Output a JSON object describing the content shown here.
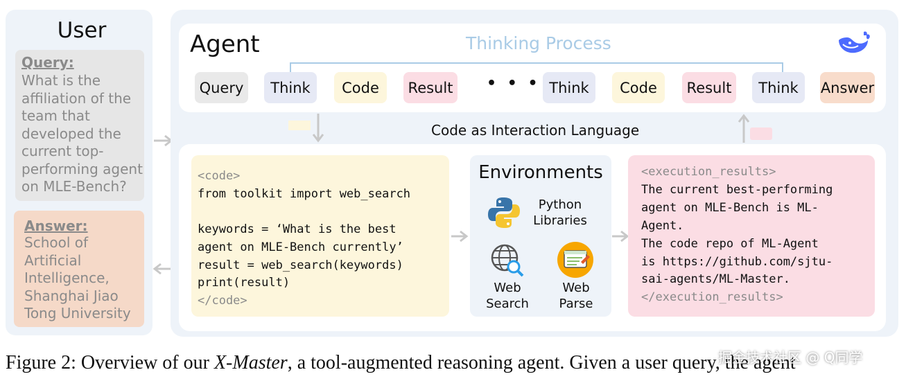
{
  "user": {
    "title": "User",
    "query_label": "Query:",
    "query_text": "What is the affiliation of the team that developed the current top-performing agent on MLE-Bench?",
    "answer_label": "Answer:",
    "answer_text": "School of Artificial Intelligence, Shanghai Jiao Tong University"
  },
  "agent": {
    "title": "Agent",
    "thinking_label": "Thinking Process",
    "logo_icon": "whale-icon",
    "flow": [
      {
        "label": "Query",
        "color": "#e9e9e9"
      },
      {
        "label": "Think",
        "color": "#e6e9f5"
      },
      {
        "label": "Code",
        "color": "#fdf6dc"
      },
      {
        "label": "Result",
        "color": "#fbdde4"
      },
      {
        "label": "Think",
        "color": "#e6e9f5"
      },
      {
        "label": "Code",
        "color": "#fdf6dc"
      },
      {
        "label": "Result",
        "color": "#fbdde4"
      },
      {
        "label": "Think",
        "color": "#e6e9f5"
      },
      {
        "label": "Answer",
        "color": "#f8dccb"
      }
    ],
    "ellipsis": "• • •",
    "interaction_label": "Code as Interaction Language"
  },
  "code": {
    "open_tag": "<code>",
    "lines": [
      "from toolkit import web_search",
      "",
      "keywords = ‘What is the best",
      "agent on MLE-Bench currently’",
      "result = web_search(keywords)",
      "print(result)"
    ],
    "close_tag": "</code>"
  },
  "environments": {
    "title": "Environments",
    "python_label": "Python Libraries",
    "web_search_label": "Web Search",
    "web_parse_label": "Web Parse",
    "icons": [
      "python-logo-icon",
      "globe-search-icon",
      "web-parse-icon"
    ]
  },
  "results": {
    "open_tag": "<execution_results>",
    "lines": [
      "The current best-performing",
      "agent on MLE-Bench is ML-",
      "Agent.",
      "The code repo of ML-Agent",
      "is https://github.com/sjtu-",
      "sai-agents/ML-Master."
    ],
    "close_tag": "</execution_results>"
  },
  "caption": {
    "prefix": "Figure 2: Overview of our ",
    "name": "X-Master",
    "suffix": ", a tool-augmented reasoning agent. Given a user query, the agent"
  },
  "watermark": "掘金技术社区 @ Q同学",
  "colors": {
    "panel_bg": "#eef3f9",
    "thinking_blue": "#a9cbe6",
    "code_bg": "#fdf6dc",
    "result_bg": "#fbdde4",
    "answer_bg": "#f8dccb",
    "arrow_gray": "#c8c8c8"
  }
}
